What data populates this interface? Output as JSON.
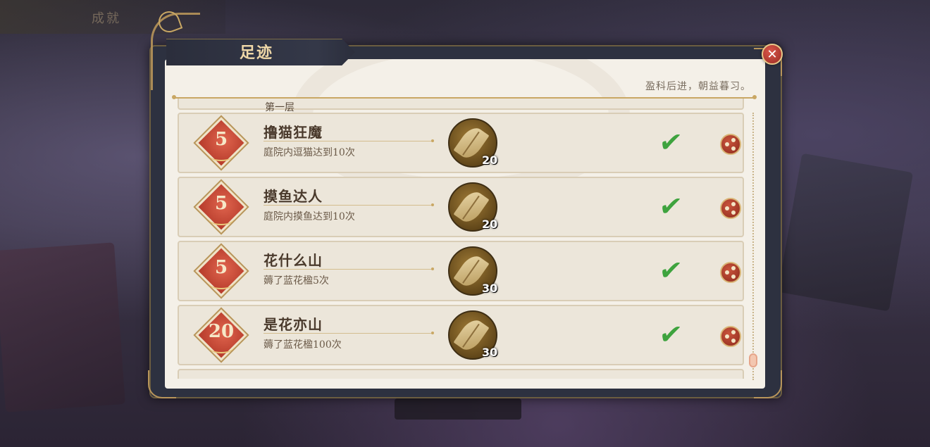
{
  "background": {
    "menu_label": "成就"
  },
  "panel": {
    "title": "足迹",
    "tagline": "盈科后进，朝益暮习。",
    "partial_top_label": "第一层"
  },
  "achievements": [
    {
      "badge": "5",
      "title": "撸猫狂魔",
      "desc": "庭院内逗猫达到10次",
      "reward_icon": "leaf-icon",
      "reward_count": "20",
      "completed": true
    },
    {
      "badge": "5",
      "title": "摸鱼达人",
      "desc": "庭院内摸鱼达到10次",
      "reward_icon": "leaf-icon",
      "reward_count": "20",
      "completed": true
    },
    {
      "badge": "5",
      "title": "花什么山",
      "desc": "薅了蓝花楹5次",
      "reward_icon": "leaf-icon",
      "reward_count": "30",
      "completed": true
    },
    {
      "badge": "20",
      "title": "是花亦山",
      "desc": "薅了蓝花楹100次",
      "reward_icon": "leaf-icon",
      "reward_count": "30",
      "completed": true
    }
  ],
  "icons": {
    "close": "close-icon",
    "check": "checkmark-icon",
    "share": "share-icon"
  },
  "glyphs": {
    "close": "✕",
    "check": "✔"
  },
  "colors": {
    "accent_gold": "#c9a764",
    "badge_red": "#c94a36",
    "check_green": "#3ea33e",
    "panel_bg": "#f4f0e8"
  }
}
